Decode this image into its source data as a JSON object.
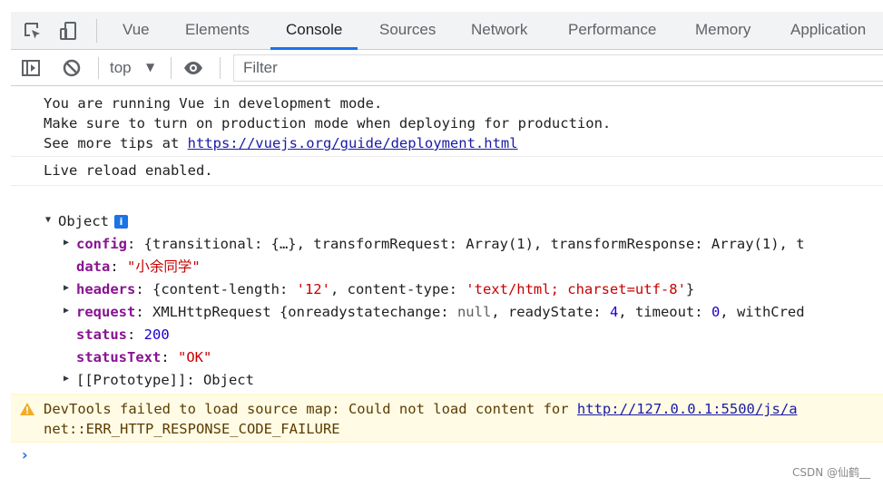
{
  "tabs": [
    {
      "label": "Vue"
    },
    {
      "label": "Elements"
    },
    {
      "label": "Console"
    },
    {
      "label": "Sources"
    },
    {
      "label": "Network"
    },
    {
      "label": "Performance"
    },
    {
      "label": "Memory"
    },
    {
      "label": "Application"
    }
  ],
  "active_tab": "Console",
  "toolbar": {
    "context": "top",
    "filter_placeholder": "Filter"
  },
  "console": {
    "vue_msg": {
      "line1": "You are running Vue in development mode.",
      "line2": "Make sure to turn on production mode when deploying for production.",
      "line3_prefix": "See more tips at ",
      "line3_link": "https://vuejs.org/guide/deployment.html"
    },
    "live_reload": "Live reload enabled.",
    "object": {
      "label": "Object",
      "info_badge": "i",
      "config_key": "config",
      "config_value": "{transitional: {…}, transformRequest: Array(1), transformResponse: Array(1), t",
      "data_key": "data",
      "data_value": "\"小余同学\"",
      "headers_key": "headers",
      "headers_open": "{content-length: ",
      "headers_cl": "'12'",
      "headers_mid": ", content-type: ",
      "headers_ct": "'text/html; charset=utf-8'",
      "headers_close": "}",
      "request_key": "request",
      "request_a": "XMLHttpRequest {onreadystatechange: ",
      "request_null": "null",
      "request_b": ", readyState: ",
      "request_rs": "4",
      "request_c": ", timeout: ",
      "request_to": "0",
      "request_d": ", withCred",
      "status_key": "status",
      "status_value": "200",
      "statusText_key": "statusText",
      "statusText_value": "\"OK\"",
      "prototype": "[[Prototype]]: Object"
    },
    "warning": {
      "prefix": "DevTools failed to load source map: Could not load content for ",
      "link": "http://127.0.0.1:5500/js/a",
      "line2": "net::ERR_HTTP_RESPONSE_CODE_FAILURE"
    },
    "prompt": "›"
  },
  "watermark": "CSDN @仙鹤__",
  "colors": {
    "accent": "#1a73e8",
    "warning_bg": "#fffbe5",
    "string": "#c80000",
    "property": "#881391",
    "number": "#1c00cf"
  },
  "icons": [
    "inspect-icon",
    "device-toolbar-icon",
    "sidebar-toggle-icon",
    "clear-console-icon",
    "context-caret-icon",
    "eye-icon",
    "warning-icon",
    "info-icon",
    "expand-triangle-icon"
  ]
}
